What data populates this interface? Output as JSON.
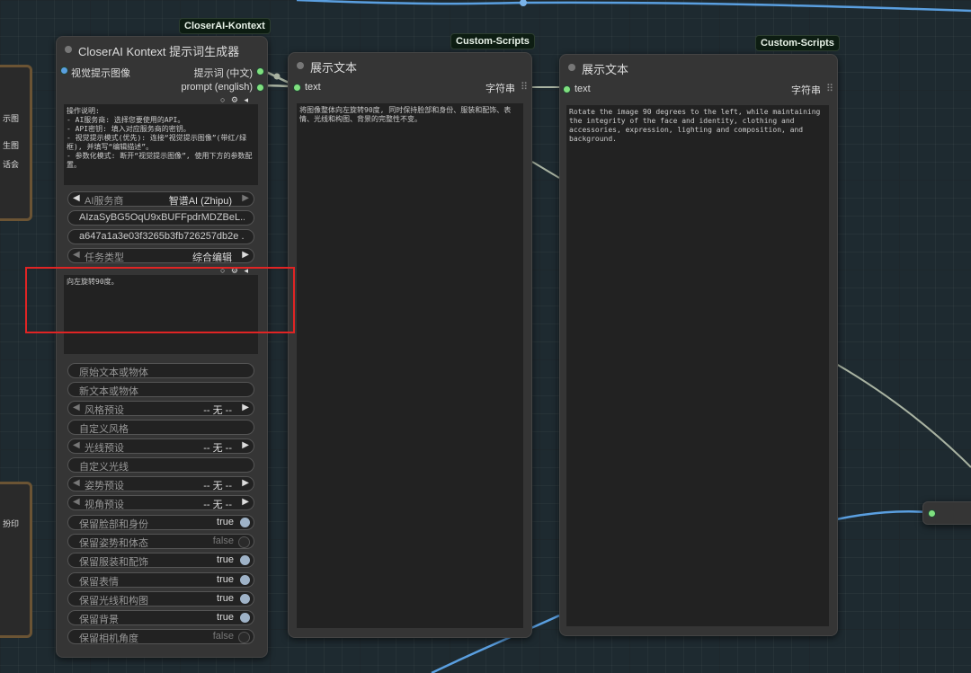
{
  "left_side_nodes": {
    "top_texts": [
      "示图",
      "生图",
      "话会"
    ],
    "bottom_texts": [
      "扮印"
    ]
  },
  "kontext_node": {
    "badge": "CloserAI-Kontext",
    "title": "CloserAI Kontext 提示词生成器",
    "input_label": "视觉提示图像",
    "outputs": [
      "提示词 (中文)",
      "prompt (english)"
    ],
    "instructions": "操作说明:\n- AI服务商: 选择您要使用的API。\n- API密钥: 填入对应服务商的密钥。\n- 视觉提示模式(优先): 连接“视觉提示图像”(带红/绿框), 并填写“编辑描述”。\n- 参数化模式: 断开“视觉提示图像”, 使用下方的参数配置。",
    "ai_provider": {
      "label": "AI服务商",
      "value": "智谱AI (Zhipu)"
    },
    "api_key_1": "AIzaSyBG5OqU9xBUFFpdrMDZBeL...",
    "api_key_2": "a647a1a3e03f3265b3fb726257db2e ...",
    "task_type": {
      "label": "任务类型",
      "value": "综合编辑"
    },
    "edit_text": "向左旋转90度。",
    "text_widgets": [
      "原始文本或物体",
      "新文本或物体"
    ],
    "style_preset": {
      "label": "风格预设",
      "value": "-- 无 --"
    },
    "custom_style": "自定义风格",
    "light_preset": {
      "label": "光线预设",
      "value": "-- 无 --"
    },
    "custom_light": "自定义光线",
    "pose_preset": {
      "label": "姿势预设",
      "value": "-- 无 --"
    },
    "view_preset": {
      "label": "视角预设",
      "value": "-- 无 --"
    },
    "toggles": [
      {
        "label": "保留脸部和身份",
        "value": "true"
      },
      {
        "label": "保留姿势和体态",
        "value": "false"
      },
      {
        "label": "保留服装和配饰",
        "value": "true"
      },
      {
        "label": "保留表情",
        "value": "true"
      },
      {
        "label": "保留光线和构图",
        "value": "true"
      },
      {
        "label": "保留背景",
        "value": "true"
      },
      {
        "label": "保留相机角度",
        "value": "false"
      }
    ]
  },
  "show_text_1": {
    "badge": "Custom-Scripts",
    "title": "展示文本",
    "input": "text",
    "output": "字符串",
    "content": "将图像整体向左旋转90度, 同时保持脸部和身份、服装和配饰、表情、光线和构图、背景的完整性不变。"
  },
  "show_text_2": {
    "badge": "Custom-Scripts",
    "title": "展示文本",
    "input": "text",
    "output": "字符串",
    "content": "Rotate the image 90 degrees to the left, while maintaining the integrity of the face and identity, clothing and accessories, expression, lighting and composition, and background."
  },
  "colors": {
    "canvas": "#1e2a30",
    "node": "#353535",
    "wire_blue": "#5a9fe0",
    "wire_gray": "#a9b3a2",
    "slot_green": "#7fe07f",
    "highlight": "#e02424"
  }
}
